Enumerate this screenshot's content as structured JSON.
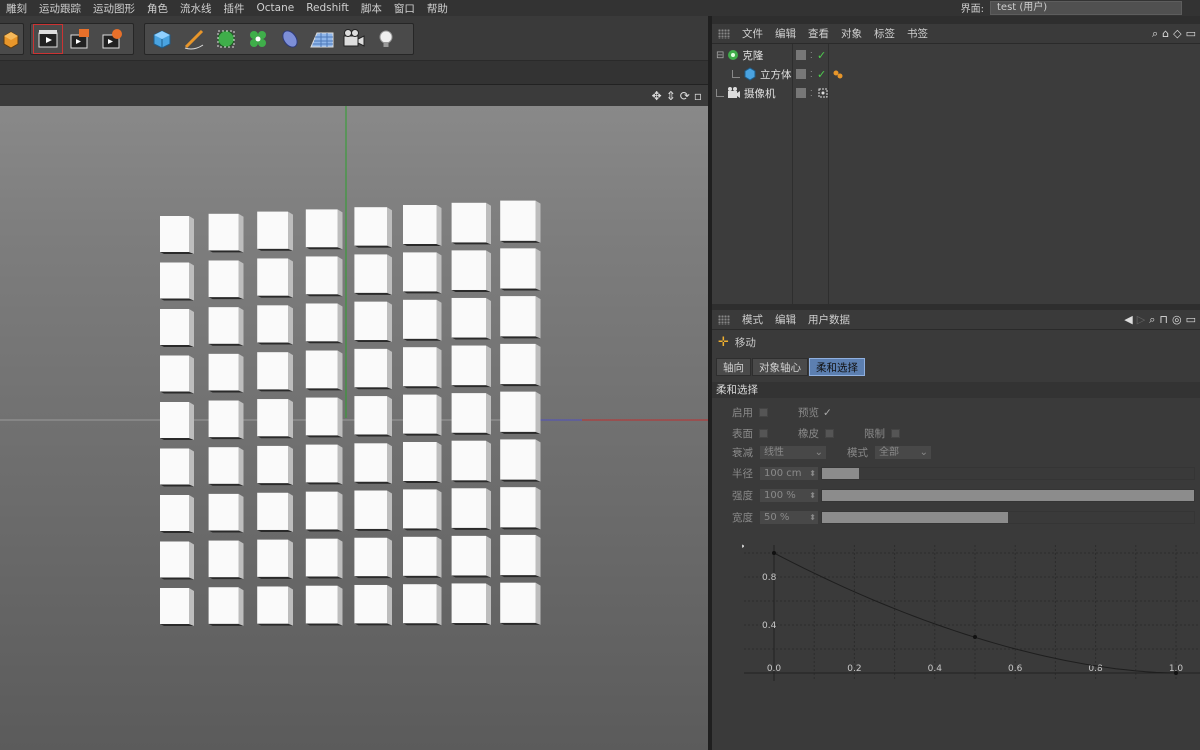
{
  "menu": [
    "雕刻",
    "运动跟踪",
    "运动图形",
    "角色",
    "流水线",
    "插件",
    "Octane",
    "Redshift",
    "脚本",
    "窗口",
    "帮助"
  ],
  "layout": {
    "label": "界面:",
    "value": "test (用户)"
  },
  "toolbar": {
    "icons": [
      "cube-extrude-icon",
      "render-view-icon",
      "render-picture-viewer-icon",
      "render-settings-icon",
      "cube-primitive-icon",
      "pen-spline-icon",
      "subdivision-icon",
      "cloner-icon",
      "deformer-icon",
      "floor-icon",
      "camera-icon",
      "light-icon"
    ]
  },
  "object_manager": {
    "menu": [
      "文件",
      "编辑",
      "查看",
      "对象",
      "标签",
      "书签"
    ],
    "objects": [
      {
        "name": "克隆",
        "icon": "cloner-icon",
        "checked": true
      },
      {
        "name": "立方体",
        "icon": "cube-icon",
        "checked": true
      },
      {
        "name": "摄像机",
        "icon": "camera-icon",
        "checked": false
      }
    ]
  },
  "attributes": {
    "menu": [
      "模式",
      "编辑",
      "用户数据"
    ],
    "tool_name": "移动",
    "tabs": [
      "轴向",
      "对象轴心",
      "柔和选择"
    ],
    "active_tab": "柔和选择",
    "section_title": "柔和选择",
    "enable_label": "启用",
    "preview_label": "预览",
    "surface_label": "表面",
    "rubber_label": "橡皮",
    "restrict_label": "限制",
    "falloff_label": "衰减",
    "falloff_value": "线性",
    "mode_label": "模式",
    "mode_value": "全部",
    "radius_label": "半径",
    "radius_value": "100 cm",
    "radius_fraction": 0.1,
    "strength_label": "强度",
    "strength_value": "100 %",
    "strength_fraction": 1.0,
    "width_label": "宽度",
    "width_value": "50 %",
    "width_fraction": 0.5,
    "curve": {
      "x_ticks": [
        "0.0",
        "0.2",
        "0.4",
        "0.6",
        "0.8",
        "1.0"
      ],
      "y_ticks": [
        "0.8",
        "0.4"
      ],
      "points": [
        [
          0.0,
          1.0
        ],
        [
          0.5,
          0.3
        ],
        [
          1.0,
          0.0
        ]
      ]
    }
  },
  "scene": {
    "grid_cols": 8,
    "grid_rows": 9
  }
}
